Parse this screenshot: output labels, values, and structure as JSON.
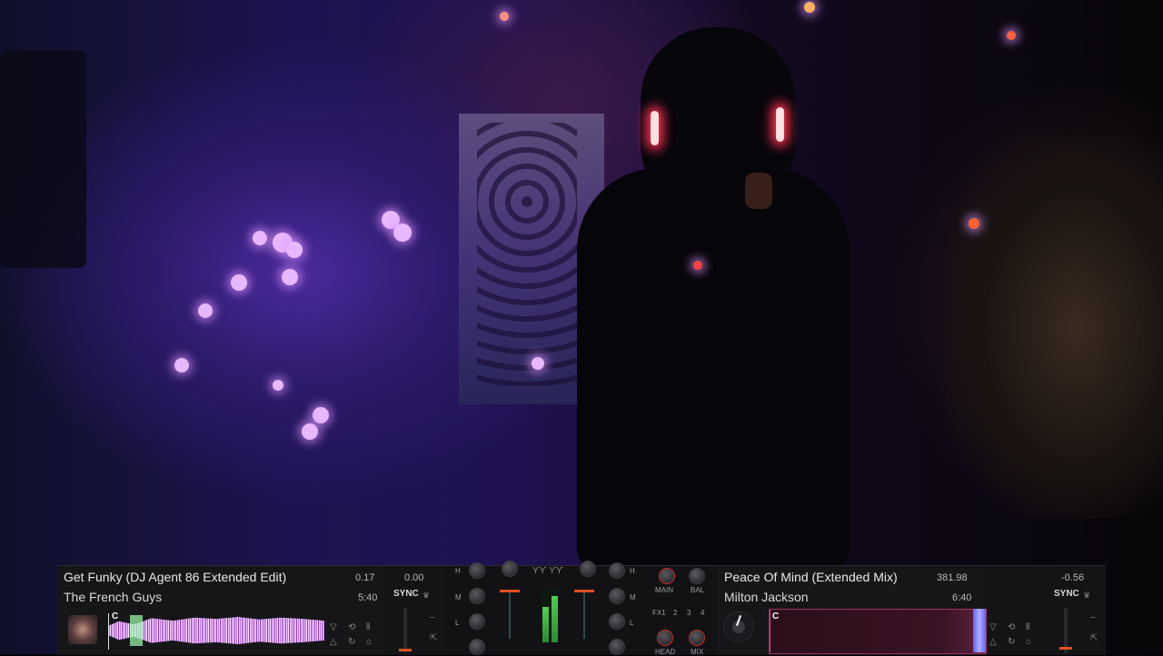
{
  "deck_a": {
    "title": "Get Funky (DJ Agent 86 Extended Edit)",
    "artist": "The French Guys",
    "bpm": "0.17",
    "pitch": "0.00",
    "remaining_time": "5:40",
    "sync_label": "SYNC",
    "cue_label": "C"
  },
  "deck_b": {
    "title": "Peace Of Mind (Extended Mix)",
    "artist": "Milton Jackson",
    "bpm": "381.98",
    "pitch": "-0.56",
    "remaining_time": "6:40",
    "sync_label": "SYNC",
    "cue_label": "C"
  },
  "mixer": {
    "eq_high": "H",
    "eq_mid": "M",
    "eq_low": "L",
    "main_label": "MAIN",
    "bal_label": "BAL",
    "fx_labels": [
      "FX1",
      "2",
      "3",
      "4"
    ],
    "head_label": "HEAD",
    "mix_label": "MIX"
  },
  "meters": {
    "left_level": 0.65,
    "right_level": 0.85
  },
  "colors": {
    "accent": "#e05020",
    "waveform_a": "#e0a0ff",
    "waveform_b_border": "#a03060"
  }
}
